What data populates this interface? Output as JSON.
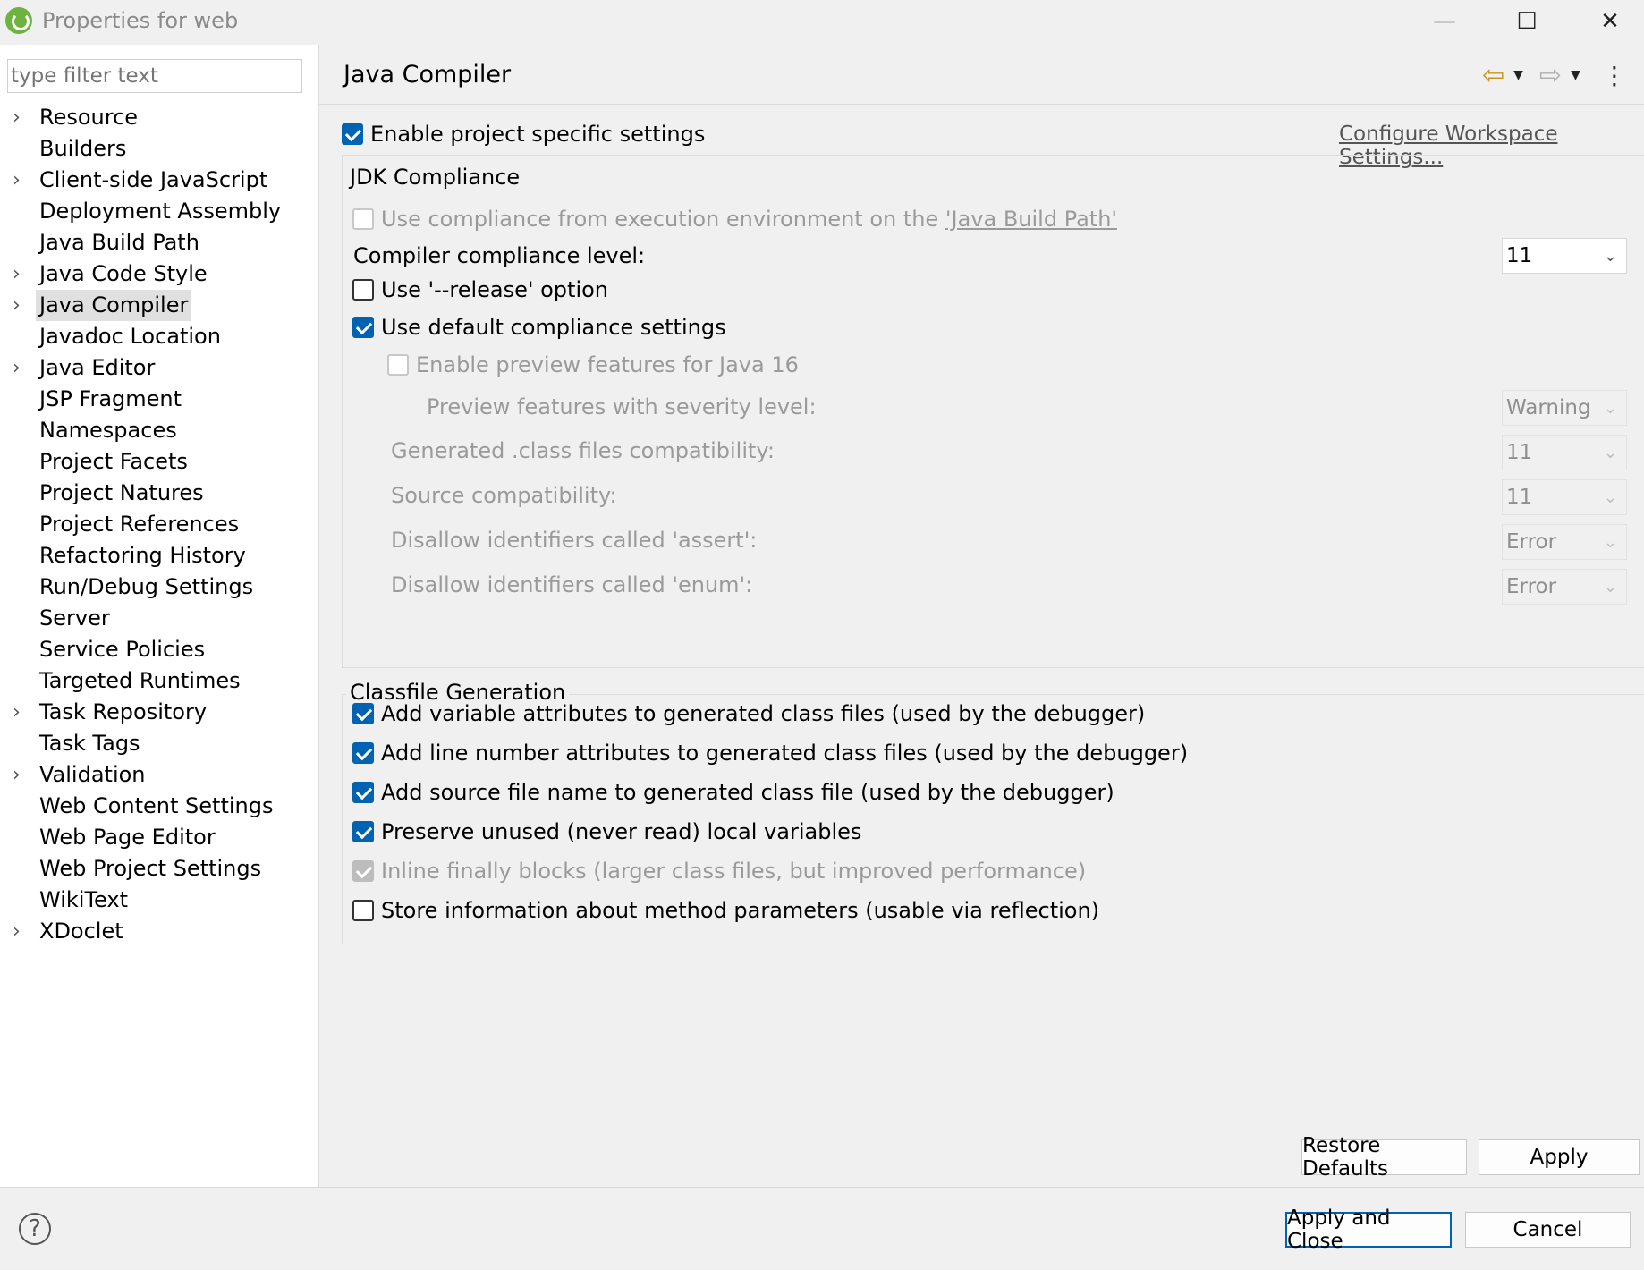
{
  "window": {
    "title": "Properties for web",
    "minimize_icon": "—",
    "maximize_icon": "☐",
    "close_icon": "✕"
  },
  "sidebar": {
    "filter_placeholder": "type filter text",
    "items": [
      {
        "label": "Resource",
        "expandable": true
      },
      {
        "label": "Builders",
        "expandable": false
      },
      {
        "label": "Client-side JavaScript",
        "expandable": true
      },
      {
        "label": "Deployment Assembly",
        "expandable": false
      },
      {
        "label": "Java Build Path",
        "expandable": false
      },
      {
        "label": "Java Code Style",
        "expandable": true
      },
      {
        "label": "Java Compiler",
        "expandable": true,
        "selected": true
      },
      {
        "label": "Javadoc Location",
        "expandable": false
      },
      {
        "label": "Java Editor",
        "expandable": true
      },
      {
        "label": "JSP Fragment",
        "expandable": false
      },
      {
        "label": "Namespaces",
        "expandable": false
      },
      {
        "label": "Project Facets",
        "expandable": false
      },
      {
        "label": "Project Natures",
        "expandable": false
      },
      {
        "label": "Project References",
        "expandable": false
      },
      {
        "label": "Refactoring History",
        "expandable": false
      },
      {
        "label": "Run/Debug Settings",
        "expandable": false
      },
      {
        "label": "Server",
        "expandable": false
      },
      {
        "label": "Service Policies",
        "expandable": false
      },
      {
        "label": "Targeted Runtimes",
        "expandable": false
      },
      {
        "label": "Task Repository",
        "expandable": true
      },
      {
        "label": "Task Tags",
        "expandable": false
      },
      {
        "label": "Validation",
        "expandable": true
      },
      {
        "label": "Web Content Settings",
        "expandable": false
      },
      {
        "label": "Web Page Editor",
        "expandable": false
      },
      {
        "label": "Web Project Settings",
        "expandable": false
      },
      {
        "label": "WikiText",
        "expandable": false
      },
      {
        "label": "XDoclet",
        "expandable": true
      }
    ]
  },
  "main": {
    "title": "Java Compiler",
    "enable_project_specific": {
      "label": "Enable project specific settings",
      "checked": true
    },
    "configure_workspace_link": "Configure Workspace Settings...",
    "jdk": {
      "group_label": "JDK Compliance",
      "use_compliance_prefix": "Use compliance from execution environment on the ",
      "use_compliance_link": "'Java Build Path'",
      "compliance_level_label": "Compiler compliance level:",
      "compliance_level_value": "11",
      "release_option": {
        "label": "Use '--release' option",
        "checked": false
      },
      "default_compliance": {
        "label": "Use default compliance settings",
        "checked": true
      },
      "preview_features": {
        "label": "Enable preview features for Java 16",
        "checked": false
      },
      "preview_severity_label": "Preview features with severity level:",
      "preview_severity_value": "Warning",
      "generated_class_label": "Generated .class files compatibility:",
      "generated_class_value": "11",
      "source_compat_label": "Source compatibility:",
      "source_compat_value": "11",
      "assert_label": "Disallow identifiers called 'assert':",
      "assert_value": "Error",
      "enum_label": "Disallow identifiers called 'enum':",
      "enum_value": "Error"
    },
    "classfile": {
      "group_label": "Classfile Generation",
      "options": [
        {
          "label": "Add variable attributes to generated class files (used by the debugger)",
          "checked": true,
          "disabled": false
        },
        {
          "label": "Add line number attributes to generated class files (used by the debugger)",
          "checked": true,
          "disabled": false
        },
        {
          "label": "Add source file name to generated class file (used by the debugger)",
          "checked": true,
          "disabled": false
        },
        {
          "label": "Preserve unused (never read) local variables",
          "checked": true,
          "disabled": false
        },
        {
          "label": "Inline finally blocks (larger class files, but improved performance)",
          "checked": true,
          "disabled": true
        },
        {
          "label": "Store information about method parameters (usable via reflection)",
          "checked": false,
          "disabled": false
        }
      ]
    },
    "restore_defaults_label": "Restore Defaults",
    "apply_label": "Apply"
  },
  "footer": {
    "help_icon": "?",
    "apply_close_label": "Apply and Close",
    "cancel_label": "Cancel"
  },
  "icons": {
    "back": "⇦",
    "forward": "⇨",
    "dropdown": "▼",
    "menu": "⋮",
    "chevron_right": "›",
    "chevron_down": "⌄"
  }
}
